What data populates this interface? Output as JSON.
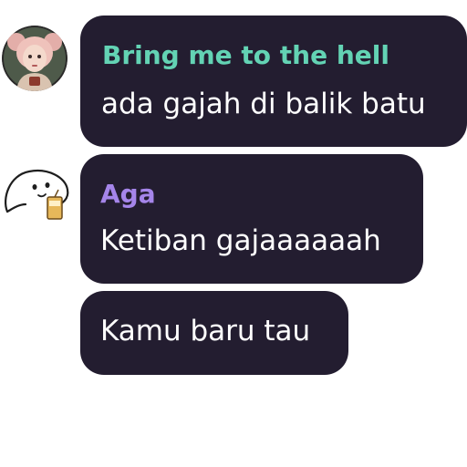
{
  "messages": [
    {
      "sender": "Bring me to the hell",
      "text": "ada gajah di balik batu",
      "sender_color": "#63d3b4",
      "avatar": "girl-portrait-avatar"
    },
    {
      "sender": "Aga",
      "text": "Ketiban gajaaaaaah",
      "sender_color": "#a585ea",
      "avatar": "blob-sticker-avatar"
    },
    {
      "sender": "",
      "text": "Kamu baru tau"
    }
  ],
  "colors": {
    "bubble_background": "#231d30",
    "message_text": "#ffffff",
    "page_background": "#ffffff"
  }
}
